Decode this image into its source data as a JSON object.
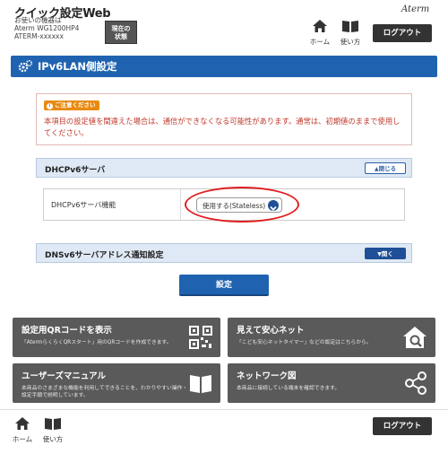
{
  "header": {
    "app_title": "クイック設定Web",
    "device_label": "お使いの機器は",
    "device_model": "Aterm WG1200HP4",
    "device_id": "ATERM-xxxxxx",
    "status_button_line1": "現在の",
    "status_button_line2": "状態",
    "home_label": "ホーム",
    "help_label": "使い方",
    "brand": "Aterm",
    "logout_label": "ログアウト"
  },
  "page": {
    "title": "IPv6LAN側設定"
  },
  "caution": {
    "badge": "ご注意ください",
    "text": "本項目の設定値を間違えた場合は、通信ができなくなる可能性があります。通常は、初期値のままで使用してください。"
  },
  "dhcp_panel": {
    "title": "DHCPv6サーバ",
    "toggle_label": "閉じる",
    "row_label": "DHCPv6サーバ機能",
    "select_value": "使用する(Stateless)"
  },
  "dns_panel": {
    "title": "DNSv6サーバアドレス通知設定",
    "toggle_label": "開く"
  },
  "submit_label": "設定",
  "tiles": [
    {
      "title": "設定用QRコードを表示",
      "desc": "「AtermらくらくQRスタート」用のQRコードを作成できます。"
    },
    {
      "title": "見えて安心ネット",
      "desc": "「こども安心ネットタイマー」などの設定はこちらから。"
    },
    {
      "title": "ユーザーズマニュアル",
      "desc": "本商品のさまざまな機能を利用してできることを、わかりやすい操作・設定手順で説明しています。"
    },
    {
      "title": "ネットワーク図",
      "desc": "本商品に接続している端末を確認できます。"
    }
  ],
  "footer": {
    "home_label": "ホーム",
    "help_label": "使い方",
    "logout_label": "ログアウト"
  },
  "colors": {
    "primary": "#1f63b0",
    "caution_text": "#c0392b",
    "caution_badge": "#e88a10",
    "highlight_ring": "#e02020",
    "tile_bg": "#5a5a5a"
  }
}
